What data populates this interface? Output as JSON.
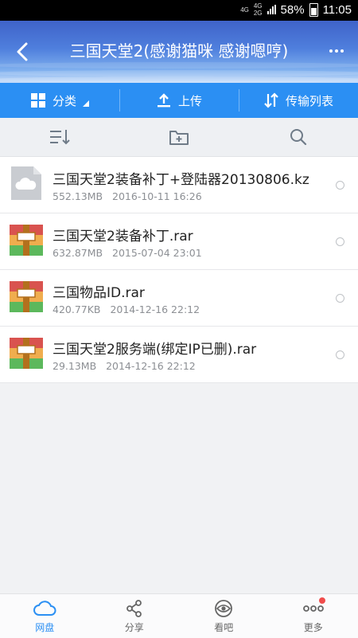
{
  "status": {
    "net1": "4G",
    "net2": "4G",
    "net2b": "2G",
    "battery": "58%",
    "time": "11:05"
  },
  "header": {
    "title": "三国天堂2(感谢猫咪 感谢嗯哼)"
  },
  "toolbar": {
    "category": "分类",
    "upload": "上传",
    "transfers": "传输列表"
  },
  "files": [
    {
      "name": "三国天堂2装备补丁+登陆器20130806.kz",
      "size": "552.13MB",
      "date": "2016-10-11  16:26",
      "type": "cloud-file-icon"
    },
    {
      "name": "三国天堂2装备补丁.rar",
      "size": "632.87MB",
      "date": "2015-07-04  23:01",
      "type": "rar-archive-icon"
    },
    {
      "name": "三国物品ID.rar",
      "size": "420.77KB",
      "date": "2014-12-16  22:12",
      "type": "rar-archive-icon"
    },
    {
      "name": "三国天堂2服务端(绑定IP已删).rar",
      "size": "29.13MB",
      "date": "2014-12-16  22:12",
      "type": "rar-archive-icon"
    }
  ],
  "nav": {
    "disk": "网盘",
    "share": "分享",
    "watch": "看吧",
    "more": "更多"
  },
  "colors": {
    "accent": "#2b8ff3",
    "badge": "#f04c4c"
  }
}
